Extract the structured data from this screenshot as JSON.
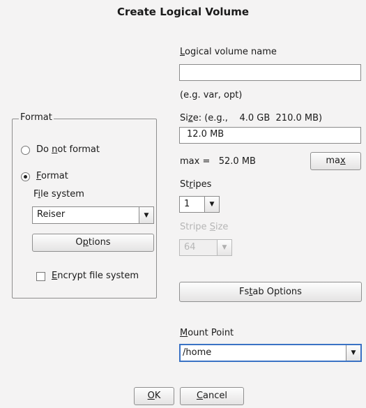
{
  "dialog": {
    "title": "Create Logical Volume"
  },
  "format": {
    "group_title": "Format",
    "radio_do_not_format": {
      "pre": "Do ",
      "key": "n",
      "post": "ot format",
      "selected": false
    },
    "radio_format": {
      "pre": "",
      "key": "F",
      "post": "ormat",
      "selected": true
    },
    "filesystem_label": {
      "pre": "F",
      "key": "i",
      "post": "le system"
    },
    "filesystem_value": "Reiser",
    "options_button": {
      "pre": "O",
      "key": "p",
      "post": "tions"
    },
    "encrypt_checkbox": {
      "pre": "",
      "key": "E",
      "post": "ncrypt file system",
      "checked": false
    }
  },
  "volume": {
    "name_label": {
      "pre": "",
      "key": "L",
      "post": "ogical volume name"
    },
    "name_value": "",
    "name_hint": "(e.g. var, opt)",
    "size_label": {
      "pre": "Si",
      "key": "z",
      "post": "e: (e.g.,    4.0 GB  210.0 MB)"
    },
    "size_value": "12.0 MB",
    "max_text": "max =   52.0 MB",
    "max_button": {
      "pre": "ma",
      "key": "x",
      "post": ""
    },
    "stripes_label": {
      "pre": "St",
      "key": "r",
      "post": "ipes"
    },
    "stripes_value": "1",
    "stripe_size_label": {
      "pre": "Stripe ",
      "key": "S",
      "post": "ize"
    },
    "stripe_size_value": "64",
    "fstab_button": {
      "pre": "Fs",
      "key": "t",
      "post": "ab Options"
    },
    "mount_label": {
      "pre": "",
      "key": "M",
      "post": "ount Point"
    },
    "mount_value": "/home"
  },
  "footer": {
    "ok_button": {
      "pre": "",
      "key": "O",
      "post": "K"
    },
    "cancel_button": {
      "pre": "",
      "key": "C",
      "post": "ancel"
    }
  }
}
